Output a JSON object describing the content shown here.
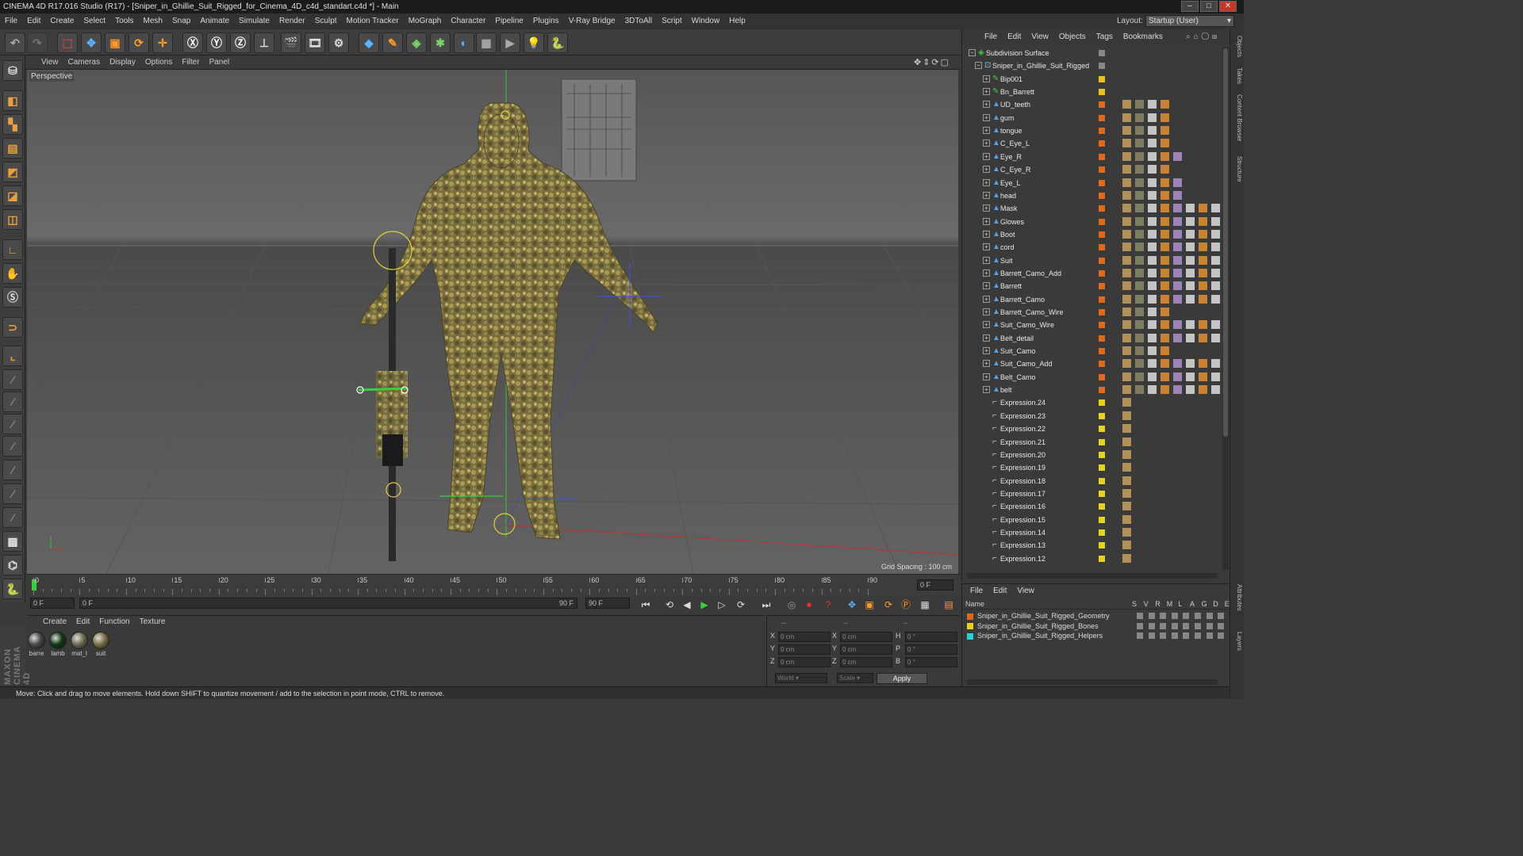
{
  "window": {
    "title": "CINEMA 4D R17.016 Studio (R17) - [Sniper_in_Ghillie_Suit_Rigged_for_Cinema_4D_c4d_standart.c4d *] - Main"
  },
  "menubar": [
    "File",
    "Edit",
    "Create",
    "Select",
    "Tools",
    "Mesh",
    "Snap",
    "Animate",
    "Simulate",
    "Render",
    "Sculpt",
    "Motion Tracker",
    "MoGraph",
    "Character",
    "Pipeline",
    "Plugins",
    "V-Ray Bridge",
    "3DToAll",
    "Script",
    "Window",
    "Help"
  ],
  "layout": {
    "label": "Layout:",
    "value": "Startup (User)"
  },
  "viewport": {
    "menu": [
      "View",
      "Cameras",
      "Display",
      "Options",
      "Filter",
      "Panel"
    ],
    "label": "Perspective",
    "grid_spacing": "Grid Spacing : 100 cm"
  },
  "timeline": {
    "ticks": [
      "0",
      "5",
      "10",
      "15",
      "20",
      "25",
      "30",
      "35",
      "40",
      "45",
      "50",
      "55",
      "60",
      "65",
      "70",
      "75",
      "80",
      "85",
      "90"
    ],
    "end_frame_readout": "0 F",
    "start_field": "0 F",
    "slider_left": "0 F",
    "slider_right": "90 F",
    "end_field": "90 F"
  },
  "materials": {
    "menu": [
      "Create",
      "Edit",
      "Function",
      "Texture"
    ],
    "items": [
      {
        "name": "barre",
        "color": "#4a4a48"
      },
      {
        "name": "lamb",
        "color": "#0d3a12"
      },
      {
        "name": "mat_l",
        "color": "#6e6a52"
      },
      {
        "name": "suit",
        "color": "#7a6e44"
      }
    ]
  },
  "coords": {
    "headers": [
      "--",
      "--",
      "--"
    ],
    "rows": [
      {
        "a": "X",
        "av": "0 cm",
        "b": "X",
        "bv": "0 cm",
        "c": "H",
        "cv": "0 °"
      },
      {
        "a": "Y",
        "av": "0 cm",
        "b": "Y",
        "bv": "0 cm",
        "c": "P",
        "cv": "0 °"
      },
      {
        "a": "Z",
        "av": "0 cm",
        "b": "Z",
        "bv": "0 cm",
        "c": "B",
        "cv": "0 °"
      }
    ],
    "world": "World",
    "scale": "Scale",
    "apply": "Apply"
  },
  "status": "Move: Click and drag to move elements. Hold down SHIFT to quantize movement / add to the selection in point mode, CTRL to remove.",
  "objects": {
    "menu": [
      "File",
      "Edit",
      "View",
      "Objects",
      "Tags",
      "Bookmarks"
    ],
    "items": [
      {
        "name": "Subdivision Surface",
        "level": 0,
        "kind": "subd",
        "color": "#888888",
        "tags": 0
      },
      {
        "name": "Sniper_in_Ghillie_Suit_Rigged",
        "level": 1,
        "kind": "null",
        "color": "#888888",
        "tags": 0
      },
      {
        "name": "Bip001",
        "level": 2,
        "kind": "bone",
        "color": "#e6c21a",
        "tags": 0
      },
      {
        "name": "Bn_Barrett",
        "level": 2,
        "kind": "bone",
        "color": "#e6c21a",
        "tags": 0
      },
      {
        "name": "UD_teeth",
        "level": 2,
        "kind": "mesh",
        "color": "#e06a1a",
        "tags": 4
      },
      {
        "name": "gum",
        "level": 2,
        "kind": "mesh",
        "color": "#e06a1a",
        "tags": 4
      },
      {
        "name": "tongue",
        "level": 2,
        "kind": "mesh",
        "color": "#e06a1a",
        "tags": 4
      },
      {
        "name": "C_Eye_L",
        "level": 2,
        "kind": "mesh",
        "color": "#e06a1a",
        "tags": 4
      },
      {
        "name": "Eye_R",
        "level": 2,
        "kind": "mesh",
        "color": "#e06a1a",
        "tags": 5
      },
      {
        "name": "C_Eye_R",
        "level": 2,
        "kind": "mesh",
        "color": "#e06a1a",
        "tags": 4
      },
      {
        "name": "Eye_L",
        "level": 2,
        "kind": "mesh",
        "color": "#e06a1a",
        "tags": 5
      },
      {
        "name": "head",
        "level": 2,
        "kind": "mesh",
        "color": "#e06a1a",
        "tags": 5
      },
      {
        "name": "Mask",
        "level": 2,
        "kind": "mesh",
        "color": "#e06a1a",
        "tags": 8
      },
      {
        "name": "Glowes",
        "level": 2,
        "kind": "mesh",
        "color": "#e06a1a",
        "tags": 8
      },
      {
        "name": "Boot",
        "level": 2,
        "kind": "mesh",
        "color": "#e06a1a",
        "tags": 8
      },
      {
        "name": "cord",
        "level": 2,
        "kind": "mesh",
        "color": "#e06a1a",
        "tags": 8
      },
      {
        "name": "Suit",
        "level": 2,
        "kind": "mesh",
        "color": "#e06a1a",
        "tags": 8
      },
      {
        "name": "Barrett_Camo_Add",
        "level": 2,
        "kind": "mesh",
        "color": "#e06a1a",
        "tags": 8
      },
      {
        "name": "Barrett",
        "level": 2,
        "kind": "mesh",
        "color": "#e06a1a",
        "tags": 8
      },
      {
        "name": "Barrett_Camo",
        "level": 2,
        "kind": "mesh",
        "color": "#e06a1a",
        "tags": 8
      },
      {
        "name": "Barrett_Camo_Wire",
        "level": 2,
        "kind": "mesh",
        "color": "#e06a1a",
        "tags": 4
      },
      {
        "name": "Suit_Camo_Wire",
        "level": 2,
        "kind": "mesh",
        "color": "#e06a1a",
        "tags": 8
      },
      {
        "name": "Belt_detail",
        "level": 2,
        "kind": "mesh",
        "color": "#e06a1a",
        "tags": 8
      },
      {
        "name": "Suit_Camo",
        "level": 2,
        "kind": "mesh",
        "color": "#e06a1a",
        "tags": 4
      },
      {
        "name": "Suit_Camo_Add",
        "level": 2,
        "kind": "mesh",
        "color": "#e06a1a",
        "tags": 8
      },
      {
        "name": "Belt_Camo",
        "level": 2,
        "kind": "mesh",
        "color": "#e06a1a",
        "tags": 8
      },
      {
        "name": "belt",
        "level": 2,
        "kind": "mesh",
        "color": "#e06a1a",
        "tags": 8
      },
      {
        "name": "Expression.24",
        "level": 2,
        "kind": "expr",
        "color": "#e6d21a",
        "tags": 1
      },
      {
        "name": "Expression.23",
        "level": 2,
        "kind": "expr",
        "color": "#e6d21a",
        "tags": 1
      },
      {
        "name": "Expression.22",
        "level": 2,
        "kind": "expr",
        "color": "#e6d21a",
        "tags": 1
      },
      {
        "name": "Expression.21",
        "level": 2,
        "kind": "expr",
        "color": "#e6d21a",
        "tags": 1
      },
      {
        "name": "Expression.20",
        "level": 2,
        "kind": "expr",
        "color": "#e6d21a",
        "tags": 1
      },
      {
        "name": "Expression.19",
        "level": 2,
        "kind": "expr",
        "color": "#e6d21a",
        "tags": 1
      },
      {
        "name": "Expression.18",
        "level": 2,
        "kind": "expr",
        "color": "#e6d21a",
        "tags": 1
      },
      {
        "name": "Expression.17",
        "level": 2,
        "kind": "expr",
        "color": "#e6d21a",
        "tags": 1
      },
      {
        "name": "Expression.16",
        "level": 2,
        "kind": "expr",
        "color": "#e6d21a",
        "tags": 1
      },
      {
        "name": "Expression.15",
        "level": 2,
        "kind": "expr",
        "color": "#e6d21a",
        "tags": 1
      },
      {
        "name": "Expression.14",
        "level": 2,
        "kind": "expr",
        "color": "#e6d21a",
        "tags": 1
      },
      {
        "name": "Expression.13",
        "level": 2,
        "kind": "expr",
        "color": "#e6d21a",
        "tags": 1
      },
      {
        "name": "Expression.12",
        "level": 2,
        "kind": "expr",
        "color": "#e6d21a",
        "tags": 1
      }
    ]
  },
  "layers": {
    "menu": [
      "File",
      "Edit",
      "View"
    ],
    "columns": [
      "Name",
      "S",
      "V",
      "R",
      "M",
      "L",
      "A",
      "G",
      "D",
      "E"
    ],
    "items": [
      {
        "name": "Sniper_in_Ghillie_Suit_Rigged_Geometry",
        "color": "#e06a1a"
      },
      {
        "name": "Sniper_in_Ghillie_Suit_Rigged_Bones",
        "color": "#e6d21a"
      },
      {
        "name": "Sniper_in_Ghillie_Suit_Rigged_Helpers",
        "color": "#2ad0d8"
      }
    ]
  },
  "right_tabs": [
    "Objects",
    "Takes",
    "Content Browser",
    "Structure",
    "Attributes",
    "Layers"
  ],
  "brand": "MAXON CINEMA 4D"
}
